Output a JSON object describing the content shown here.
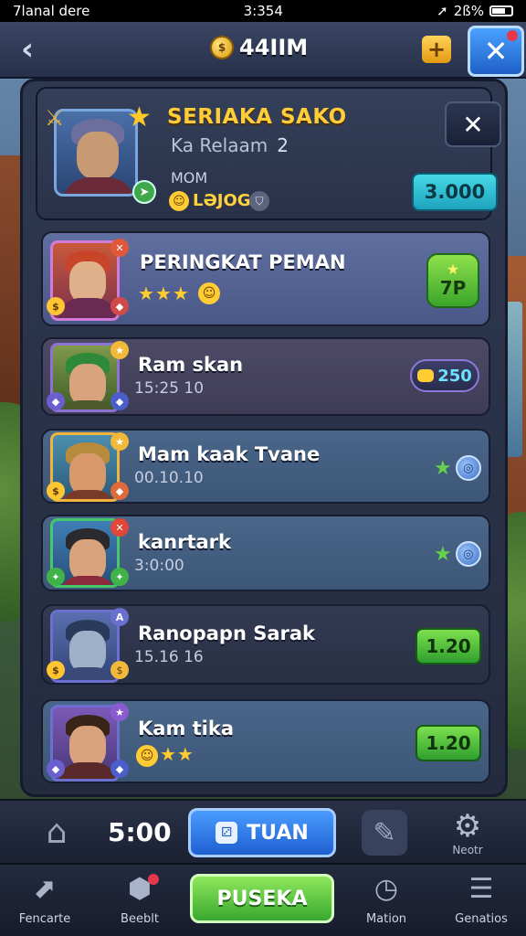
{
  "status_bar": {
    "left": "7lanal dere",
    "time": "3:354",
    "battery": "2ß%"
  },
  "top_bar": {
    "coins": "44IIM",
    "coin_icon": "gold-coin",
    "back_icon": "‹",
    "plus_icon": "+",
    "close_icon": "✕"
  },
  "profile": {
    "name": "SERIAKA SAKO",
    "subtitle": "Ka Relaam",
    "subtitle_num": "2",
    "mom": "MOM",
    "status": "LƏJOG",
    "amount": "3.000",
    "close_icon": "✕"
  },
  "rows": [
    {
      "title": "PERINGKAT PEMAN",
      "stars": "★★★",
      "badge_star": "★",
      "badge_value": "7P"
    },
    {
      "title": "Ram skan",
      "sub": "15:25 10",
      "value": "250"
    },
    {
      "title": "Mam kaak Tvane",
      "sub": "00.10.10"
    },
    {
      "title": "kanrtark",
      "sub": "3:0:00"
    },
    {
      "title": "Ranopapn Sarak",
      "sub": "15.16 16",
      "value": "1.20"
    },
    {
      "title": "Kam tika",
      "stars": "★★",
      "value": "1.20"
    }
  ],
  "mid_bar": {
    "timer": "5:00",
    "turn_label": "TUAN",
    "gear_label": "Neotr"
  },
  "bottom_nav": {
    "items": [
      {
        "label": "Fencarte"
      },
      {
        "label": "Beeblt"
      },
      {
        "label": "Mation"
      },
      {
        "label": "Genatios"
      }
    ],
    "primary_label": "PUSEKA"
  },
  "colors": {
    "accent_gold": "#ffcc3a",
    "cyan_button": "#46d9e8",
    "green_button": "#38a82f",
    "blue_button": "#1f5fd1",
    "panel_bg": "#2e3850"
  }
}
